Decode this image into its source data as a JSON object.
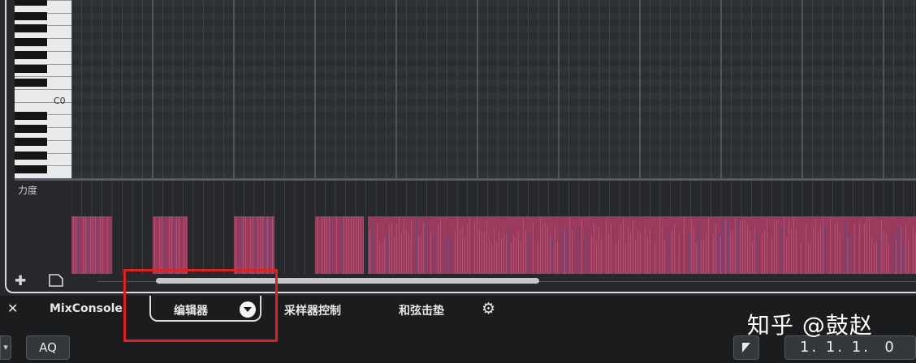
{
  "piano": {
    "note_label": "C0"
  },
  "velocity": {
    "label": "力度"
  },
  "scroll": {
    "add_icon": "plus-icon",
    "page_icon": "page-icon"
  },
  "tabs": {
    "close_label": "✕",
    "items": [
      "MixConsole",
      "编辑器",
      "采样器控制",
      "和弦击垫"
    ],
    "active": "编辑器",
    "settings_icon": "⚙"
  },
  "bottom": {
    "edge_label": "▾",
    "aq_label": "AQ",
    "position_value": "1. 1. 1.  0"
  },
  "watermark": "知乎 @鼓赵",
  "colors": {
    "velocity_bar": "#9a3a5c",
    "velocity_bar_alt": "#6d4478",
    "highlight": "#e0201c"
  }
}
